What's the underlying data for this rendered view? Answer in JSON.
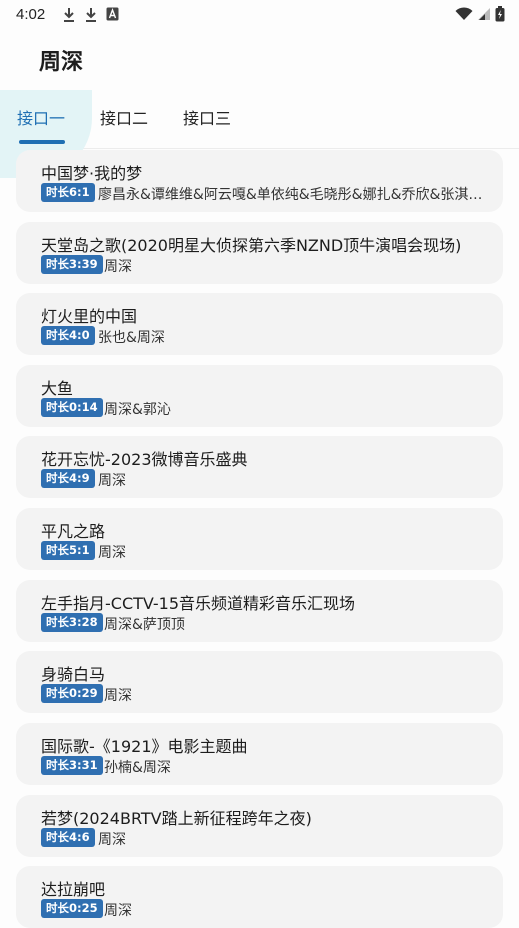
{
  "status_bar": {
    "time": "4:02",
    "left_icons": [
      "download-icon",
      "download-icon",
      "text-icon"
    ],
    "right_icons": [
      "wifi-icon",
      "signal-icon",
      "battery-icon"
    ]
  },
  "app_title": "周深",
  "tabs": [
    {
      "label": "接口一",
      "active": true
    },
    {
      "label": "接口二",
      "active": false
    },
    {
      "label": "接口三",
      "active": false
    }
  ],
  "songs": [
    {
      "title": "中国梦·我的梦",
      "duration": "时长6:1",
      "artist": "廖昌永&谭维维&阿云嘎&单依纯&毛晓彤&娜扎&乔欣&张淇…"
    },
    {
      "title": "天堂岛之歌(2020明星大侦探第六季NZND顶牛演唱会现场)",
      "duration": "时长3:39",
      "artist": "周深"
    },
    {
      "title": "灯火里的中国",
      "duration": "时长4:0",
      "artist": "张也&周深"
    },
    {
      "title": "大鱼",
      "duration": "时长0:14",
      "artist": "周深&郭沁"
    },
    {
      "title": "花开忘忧-2023微博音乐盛典",
      "duration": "时长4:9",
      "artist": "周深"
    },
    {
      "title": "平凡之路",
      "duration": "时长5:1",
      "artist": "周深"
    },
    {
      "title": "左手指月-CCTV-15音乐频道精彩音乐汇现场",
      "duration": "时长3:28",
      "artist": "周深&萨顶顶"
    },
    {
      "title": "身骑白马",
      "duration": "时长0:29",
      "artist": "周深"
    },
    {
      "title": "国际歌-《1921》电影主题曲",
      "duration": "时长3:31",
      "artist": "孙楠&周深"
    },
    {
      "title": "若梦(2024BRTV踏上新征程跨年之夜)",
      "duration": "时长4:6",
      "artist": "周深"
    },
    {
      "title": "达拉崩吧",
      "duration": "时长0:25",
      "artist": "周深"
    }
  ],
  "colors": {
    "accent": "#2f6fb1",
    "tab_highlight": "#e3f4f6",
    "card_bg": "#f3f3f3"
  }
}
